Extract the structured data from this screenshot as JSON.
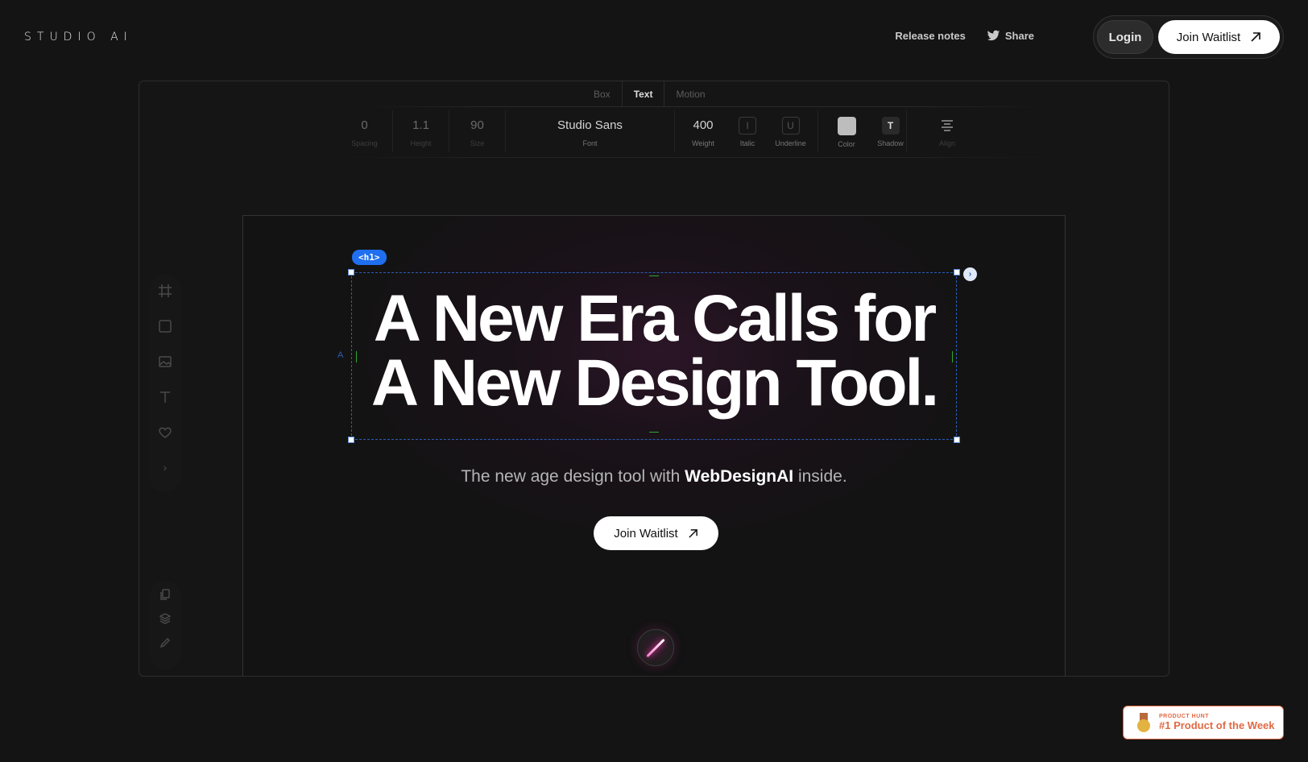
{
  "header": {
    "logo": "STUDIO AI",
    "release_notes": "Release notes",
    "share": "Share",
    "login": "Login",
    "join": "Join Waitlist"
  },
  "editor": {
    "tabs": [
      "Box",
      "Text",
      "Motion"
    ],
    "active_tab": "Text",
    "toolbar": [
      {
        "value": "0",
        "label": "Spacing"
      },
      {
        "value": "1.1",
        "label": "Height"
      },
      {
        "value": "90",
        "label": "Size"
      },
      {
        "value": "Studio Sans",
        "label": "Font"
      },
      {
        "value": "400",
        "label": "Weight"
      },
      {
        "value": "I",
        "label": "Italic"
      },
      {
        "value": "U",
        "label": "Underline"
      },
      {
        "value": "",
        "label": "Color"
      },
      {
        "value": "T",
        "label": "Shadow"
      },
      {
        "value": "",
        "label": "Align"
      }
    ],
    "selection_tag": "<h1>",
    "side_marker": "A"
  },
  "hero": {
    "line1": "A New Era Calls for",
    "line2": "A New Design Tool.",
    "sub_prefix": "The new age design tool with ",
    "sub_bold": "WebDesignAI",
    "sub_suffix": " inside.",
    "cta": "Join Waitlist"
  },
  "badge": {
    "small": "PRODUCT HUNT",
    "big": "#1 Product of the Week"
  },
  "colors": {
    "background": "#141414",
    "accent_blue": "#1f6ff0",
    "product_hunt": "#e06a44"
  }
}
